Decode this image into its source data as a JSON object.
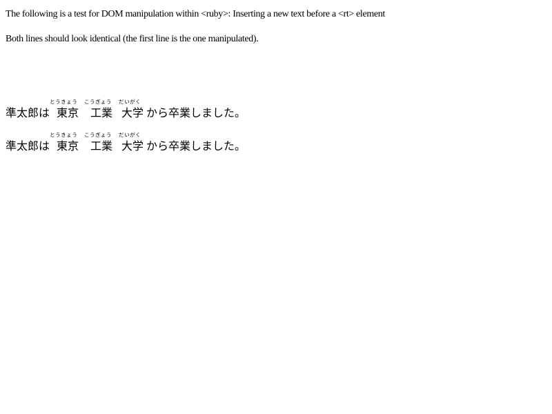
{
  "intro": {
    "line1": "The following is a test for DOM manipulation within <ruby>: Inserting a new text before a <rt> element",
    "line2": "Both lines should look identical (the first line is the one manipulated)."
  },
  "ruby_lines": [
    {
      "prefix": "準太郎は",
      "base_words": [
        "東京",
        "工業",
        "大学"
      ],
      "annotations": [
        "とうきょう",
        "こうぎょう",
        "だいがく"
      ],
      "suffix": "から卒業しました。"
    },
    {
      "prefix": "準太郎は",
      "base_words": [
        "東京",
        "工業",
        "大学"
      ],
      "annotations": [
        "とうきょう",
        "こうぎょう",
        "だいがく"
      ],
      "suffix": "から卒業しました。"
    }
  ]
}
